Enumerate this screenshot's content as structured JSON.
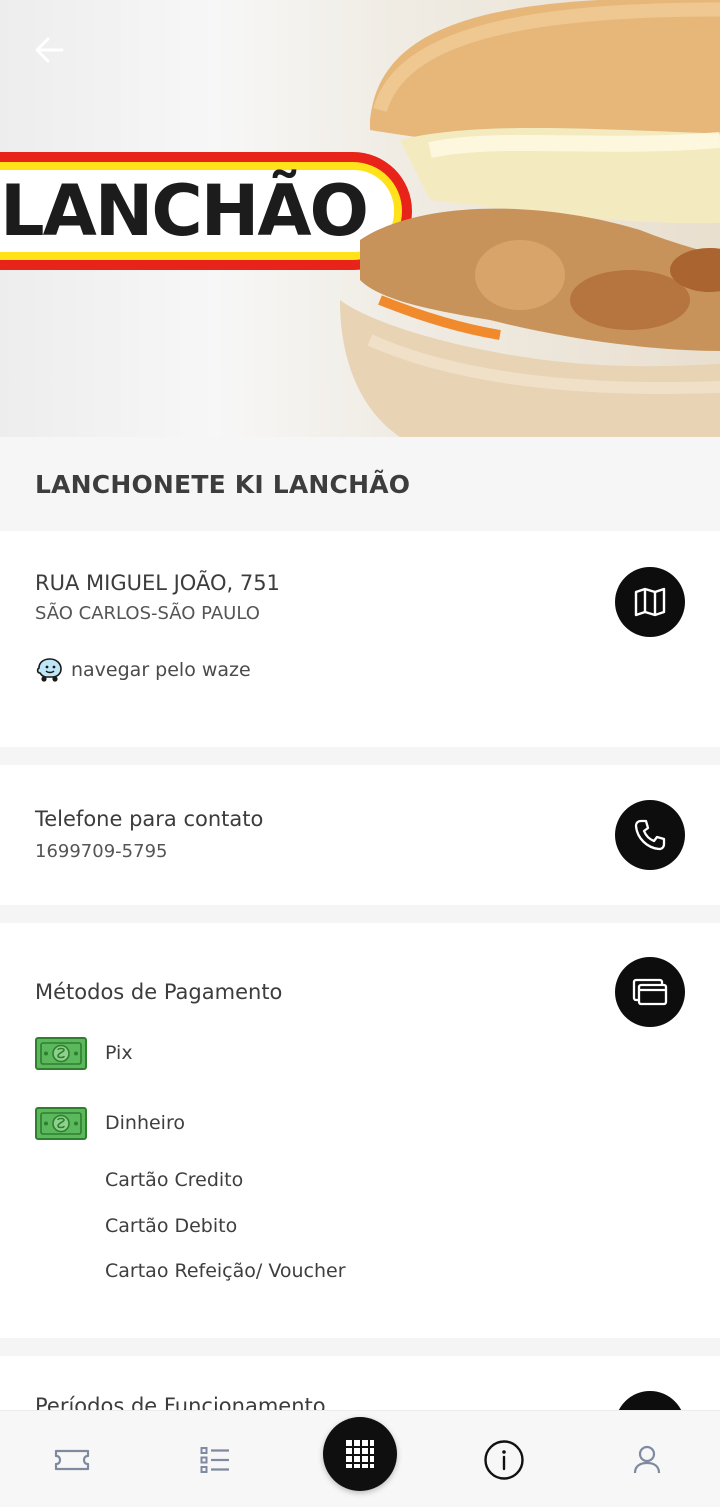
{
  "header": {
    "back_icon": "arrow-left-icon",
    "banner_logo_text": "LANCHÃO"
  },
  "restaurant": {
    "name": "LANCHONETE KI LANCHÃO"
  },
  "address": {
    "street": "RUA MIGUEL JOÃO, 751",
    "city": "SÃO CARLOS-SÃO PAULO",
    "waze_label": "navegar pelo waze",
    "map_icon": "map-icon"
  },
  "contact": {
    "title": "Telefone para contato",
    "phone": "1699709-5795",
    "phone_icon": "phone-icon"
  },
  "payment": {
    "title": "Métodos de Pagamento",
    "icon": "cards-icon",
    "methods": [
      {
        "label": "Pix",
        "icon": "cash-icon"
      },
      {
        "label": "Dinheiro",
        "icon": "cash-icon"
      },
      {
        "label": "Cartão Credito"
      },
      {
        "label": "Cartão Debito"
      },
      {
        "label": "Cartao Refeição/ Voucher"
      }
    ]
  },
  "hours": {
    "title": "Períodos de Funcionamento"
  },
  "tabbar": {
    "items": [
      "ticket-icon",
      "list-icon",
      "grid-icon",
      "info-icon",
      "user-icon"
    ],
    "active": "info-icon"
  },
  "colors": {
    "accent": "#0d0d0d",
    "logo_red": "#e7231a",
    "logo_yellow": "#ffe21a",
    "bill_green": "#3c9a3c"
  }
}
